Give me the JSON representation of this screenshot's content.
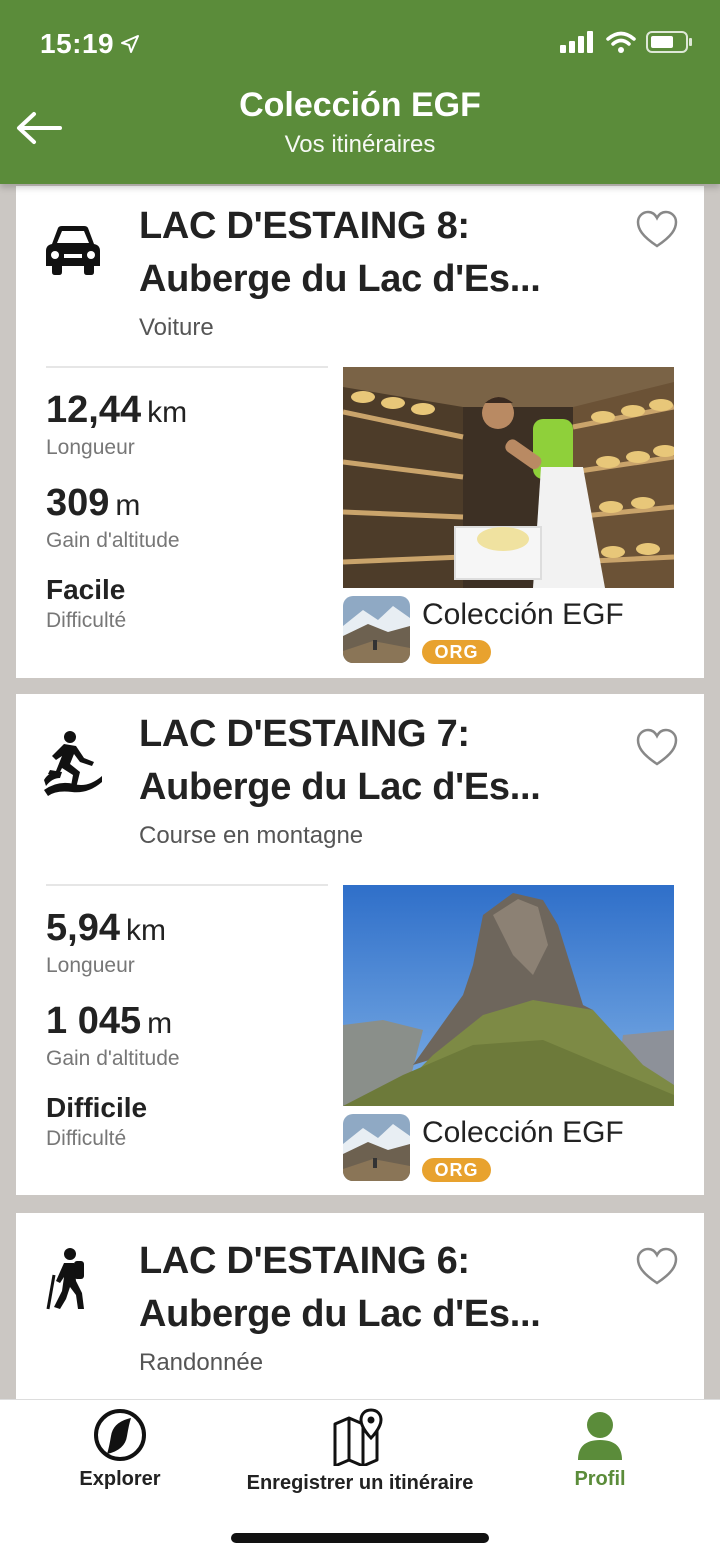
{
  "status_bar": {
    "time": "15:19"
  },
  "header": {
    "title": "Colección EGF",
    "subtitle": "Vos itinéraires"
  },
  "cards": [
    {
      "icon": "car-icon",
      "title": "LAC D'ESTAING 8:\nAuberge du Lac d'Es...",
      "type": "Voiture",
      "length_value": "12,44",
      "length_unit": "km",
      "length_label": "Longueur",
      "gain_value": "309",
      "gain_unit": "m",
      "gain_label": "Gain d'altitude",
      "difficulty_value": "Facile",
      "difficulty_label": "Difficulté",
      "org_name": "Colección EGF",
      "org_badge": "ORG"
    },
    {
      "icon": "mountain-running-icon",
      "title": "LAC D'ESTAING 7:\nAuberge du Lac d'Es...",
      "type": "Course en montagne",
      "length_value": "5,94",
      "length_unit": "km",
      "length_label": "Longueur",
      "gain_value": "1 045",
      "gain_unit": "m",
      "gain_label": "Gain d'altitude",
      "difficulty_value": "Difficile",
      "difficulty_label": "Difficulté",
      "org_name": "Colección EGF",
      "org_badge": "ORG"
    },
    {
      "icon": "hiking-icon",
      "title": "LAC D'ESTAING 6:\nAuberge du Lac d'Es...",
      "type": "Randonnée"
    }
  ],
  "bottom_nav": {
    "explore": "Explorer",
    "record": "Enregistrer un itinéraire",
    "profile": "Profil"
  },
  "colors": {
    "brand_green": "#5b8c3a",
    "org_badge": "#e8a22e"
  }
}
